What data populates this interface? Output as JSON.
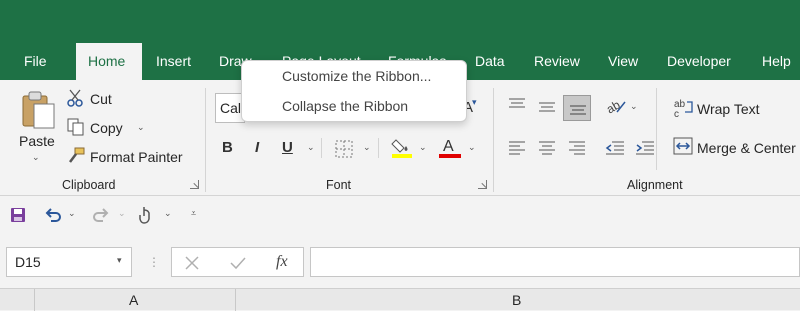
{
  "tabs": [
    "File",
    "Home",
    "Insert",
    "Draw",
    "Page Layout",
    "Formulas",
    "Data",
    "Review",
    "View",
    "Developer",
    "Help"
  ],
  "active_tab": "Home",
  "clipboard": {
    "paste_label": "Paste",
    "cut_label": "Cut",
    "copy_label": "Copy",
    "format_painter_label": "Format Painter",
    "group_label": "Clipboard"
  },
  "font": {
    "font_name_value": "Cal",
    "bold_label": "B",
    "italic_label": "I",
    "underline_label": "U",
    "group_label": "Font",
    "highlight_color": "#ffff00",
    "font_color": "#e00000"
  },
  "alignment": {
    "wrap_text_label": "Wrap Text",
    "merge_center_label": "Merge & Center",
    "group_label": "Alignment"
  },
  "context_menu": {
    "items": [
      "Customize the Ribbon...",
      "Collapse the Ribbon"
    ]
  },
  "formula_bar": {
    "name_box_value": "D15",
    "fx_label": "fx",
    "formula_value": ""
  },
  "columns": [
    "A",
    "B"
  ],
  "colors": {
    "brand": "#1e7145",
    "active_tab_text": "#1e7145"
  }
}
